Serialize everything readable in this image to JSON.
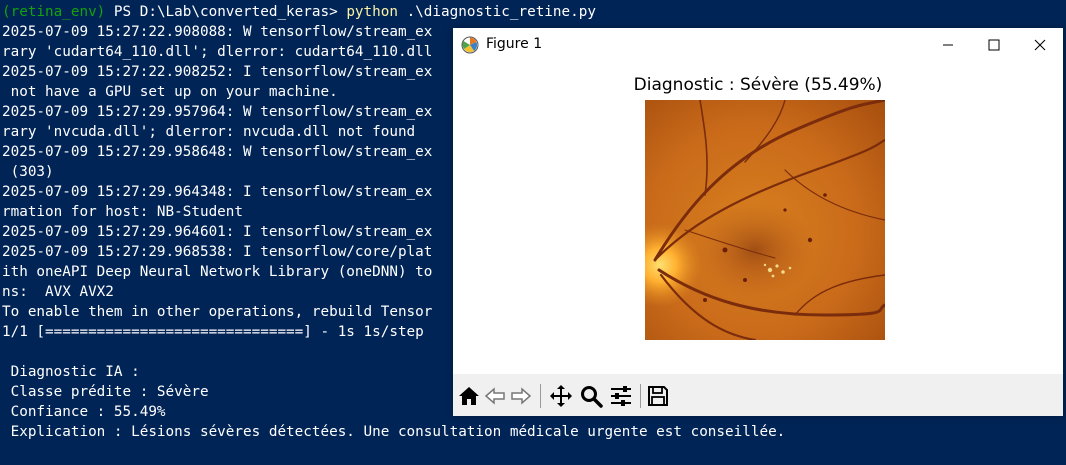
{
  "terminal": {
    "prompt_env": "(retina_env)",
    "prompt_path": " PS D:\\Lab\\converted_keras> ",
    "command": "python",
    "command_arg": " .\\diagnostic_retine.py",
    "lines": [
      "2025-07-09 15:27:22.908088: W tensorflow/stream_ex",
      "rary 'cudart64_110.dll'; dlerror: cudart64_110.dll",
      "2025-07-09 15:27:22.908252: I tensorflow/stream_ex",
      " not have a GPU set up on your machine.",
      "2025-07-09 15:27:29.957964: W tensorflow/stream_ex",
      "rary 'nvcuda.dll'; dlerror: nvcuda.dll not found",
      "2025-07-09 15:27:29.958648: W tensorflow/stream_ex",
      " (303)",
      "2025-07-09 15:27:29.964348: I tensorflow/stream_ex",
      "rmation for host: NB-Student",
      "2025-07-09 15:27:29.964601: I tensorflow/stream_ex",
      "2025-07-09 15:27:29.968538: I tensorflow/core/plat",
      "ith oneAPI Deep Neural Network Library (oneDNN) to",
      "ns:  AVX AVX2",
      "To enable them in other operations, rebuild Tensor",
      "1/1 [==============================] - 1s 1s/step",
      "",
      " Diagnostic IA :",
      " Classe prédite : Sévère",
      " Confiance : 55.49%",
      " Explication : Lésions sévères détectées. Une consultation médicale urgente est conseillée."
    ]
  },
  "figure": {
    "window_title": "Figure 1",
    "plot_title": "Diagnostic : Sévère (55.49%)",
    "toolbar": {
      "home": "home-icon",
      "back": "back-arrow-icon",
      "forward": "forward-arrow-icon",
      "pan": "move-icon",
      "zoom": "zoom-icon",
      "configure": "sliders-icon",
      "save": "save-icon"
    }
  },
  "colors": {
    "terminal_bg": "#012456",
    "prompt_env": "#13a10e",
    "command": "#f9f1a5",
    "toolbar_bg": "#f0f0f0"
  }
}
